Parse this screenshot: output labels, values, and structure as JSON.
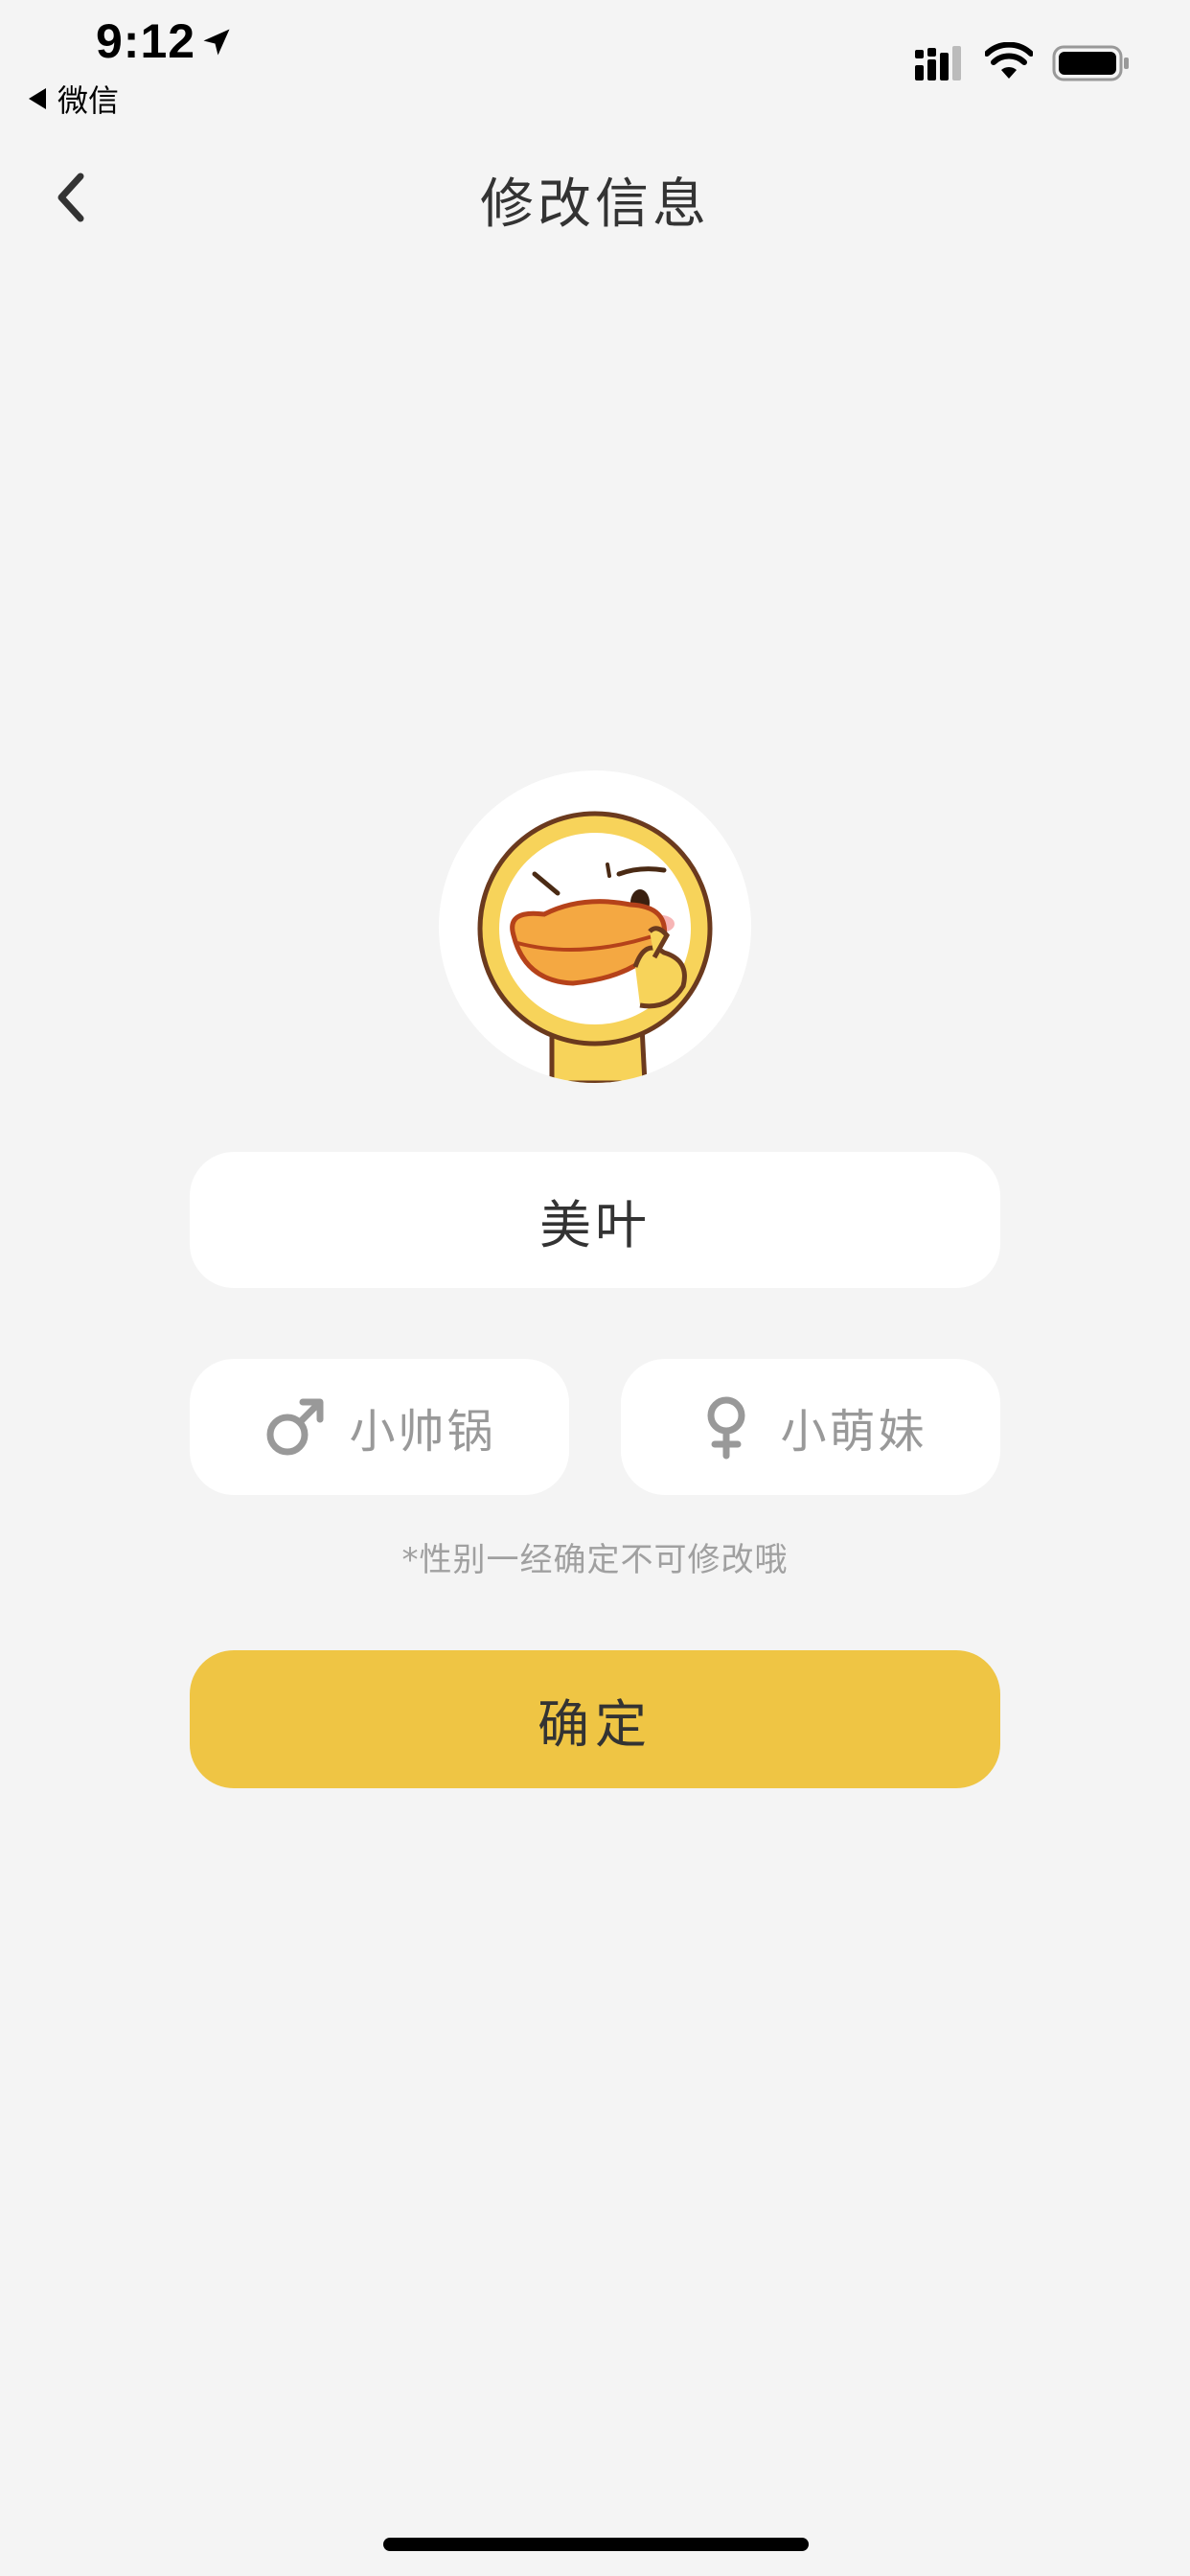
{
  "status_bar": {
    "time": "9:12",
    "back_app_label": "微信",
    "icons": [
      "location-arrow-icon",
      "cellular-signal-icon",
      "wifi-icon",
      "battery-icon"
    ]
  },
  "nav": {
    "back_icon": "chevron-left-icon",
    "title": "修改信息"
  },
  "profile": {
    "avatar": "duck-avatar",
    "name_value": "美叶",
    "name_placeholder": ""
  },
  "gender": {
    "male_label": "小帅锅",
    "male_icon": "male-symbol-icon",
    "female_label": "小萌妹",
    "female_icon": "female-symbol-icon",
    "note": "*性别一经确定不可修改哦"
  },
  "actions": {
    "confirm_label": "确定"
  },
  "colors": {
    "background": "#f4f4f4",
    "accent": "#efc544",
    "inactive_text": "#999999"
  }
}
